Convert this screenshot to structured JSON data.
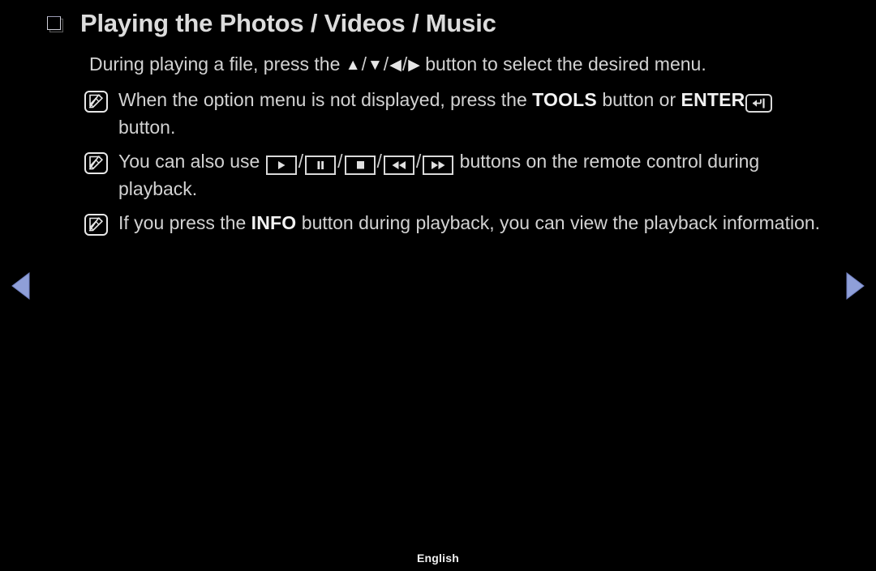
{
  "screen": {
    "background_color": "#000000",
    "text_color": "#d2d2d2",
    "accent_color": "#8f9fd8"
  },
  "header": {
    "bullet_icon": "square-bullet-icon",
    "title": "Playing the Photos / Videos / Music"
  },
  "main": {
    "lead": {
      "text_before": "During playing a file, press the",
      "keys": [
        "▲",
        "▼",
        "◀",
        "▶"
      ],
      "separator": "/",
      "text_after": "button to select the desired menu."
    },
    "notes": [
      {
        "icon": "note-pen-icon",
        "segments": [
          {
            "type": "text",
            "value": "When the option menu is not displayed, press the "
          },
          {
            "type": "bold",
            "value": "TOOLS"
          },
          {
            "type": "text",
            "value": " button or "
          },
          {
            "type": "bold",
            "value": "ENTER"
          },
          {
            "type": "key",
            "value": "enter-key-icon"
          },
          {
            "type": "text",
            "value": " button."
          }
        ],
        "plain": "When the option menu is not displayed, press the TOOLS button or ENTER↵ button."
      },
      {
        "icon": "note-pen-icon",
        "segments": [
          {
            "type": "text",
            "value": "You can also use "
          },
          {
            "type": "keybox",
            "value": "play-icon"
          },
          {
            "type": "text",
            "value": "/"
          },
          {
            "type": "keybox",
            "value": "pause-icon"
          },
          {
            "type": "text",
            "value": "/"
          },
          {
            "type": "keybox",
            "value": "stop-icon"
          },
          {
            "type": "text",
            "value": "/"
          },
          {
            "type": "keybox",
            "value": "rewind-icon"
          },
          {
            "type": "text",
            "value": "/"
          },
          {
            "type": "keybox",
            "value": "fast-forward-icon"
          },
          {
            "type": "text",
            "value": " buttons on the remote control during playback."
          }
        ],
        "plain": "You can also use ▶/❚❚/■/◀◀/▶▶ buttons on the remote control during playback."
      },
      {
        "icon": "note-pen-icon",
        "segments": [
          {
            "type": "text",
            "value": "If you press the "
          },
          {
            "type": "bold",
            "value": "INFO"
          },
          {
            "type": "text",
            "value": " button during playback, you can view the playback information."
          }
        ],
        "plain": "If you press the INFO button during playback, you can view the playback information."
      }
    ],
    "note_text": {
      "note1_a": "When the option menu is not displayed, press the ",
      "note1_tools": "TOOLS",
      "note1_b": " button or ",
      "note1_enter": "ENTER",
      "note1_c": " button.",
      "note2_a": "You can also use ",
      "note2_b": " buttons on the remote control during playback.",
      "note3_a": "If you press the ",
      "note3_info": "INFO",
      "note3_b": " button during playback, you can view the playback information."
    }
  },
  "navigation": {
    "prev_label": "previous-page",
    "next_label": "next-page",
    "arrow_color": "#8f9fd8"
  },
  "footer": {
    "language": "English"
  }
}
